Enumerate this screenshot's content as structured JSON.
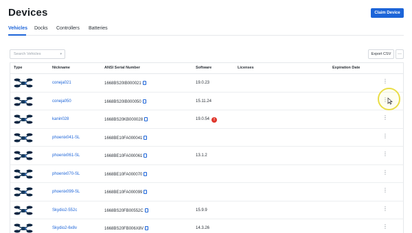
{
  "header": {
    "title": "Devices",
    "claim_label": "Claim Device"
  },
  "tabs": [
    {
      "label": "Vehicles",
      "active": true
    },
    {
      "label": "Docks",
      "active": false
    },
    {
      "label": "Controllers",
      "active": false
    },
    {
      "label": "Batteries",
      "active": false
    }
  ],
  "toolbar": {
    "search_placeholder": "Search Vehicles",
    "export_label": "Export CSV",
    "more_label": "···"
  },
  "table": {
    "columns": [
      "Type",
      "Nickname",
      "ANSI Serial Number",
      "Software",
      "Licenses",
      "Expiration Date"
    ],
    "rows": [
      {
        "nickname": "coneja021",
        "serial": "1668BS20IB000021",
        "software": "19.0.23",
        "warning": false
      },
      {
        "nickname": "coneja050",
        "serial": "1668BS20IB000050",
        "software": "15.11.24",
        "warning": false
      },
      {
        "nickname": "kanin028",
        "serial": "1668BS20KB000028",
        "software": "19.0.54",
        "warning": true
      },
      {
        "nickname": "phoenix041-SL",
        "serial": "1668BE10FA000041",
        "software": "",
        "warning": false
      },
      {
        "nickname": "phoenix061-SL",
        "serial": "1668BE10FA000061",
        "software": "13.1.2",
        "warning": false
      },
      {
        "nickname": "phoenix070-SL",
        "serial": "1668BE10FA000070",
        "software": "",
        "warning": false
      },
      {
        "nickname": "phoenix099-SL",
        "serial": "1668BE10FA000099",
        "software": "",
        "warning": false
      },
      {
        "nickname": "Skydio2-552c",
        "serial": "1668BS20FB00552C",
        "software": "15.9.9",
        "warning": false
      },
      {
        "nickname": "Skydio2-6x8v",
        "serial": "1668BS20FB006X8V",
        "software": "14.3.26",
        "warning": false
      }
    ],
    "warning_glyph": "!",
    "kebab_glyph": "⋮"
  },
  "colors": {
    "accent": "#1c64d8",
    "warning": "#e0362c",
    "highlight": "#e9dd45"
  }
}
